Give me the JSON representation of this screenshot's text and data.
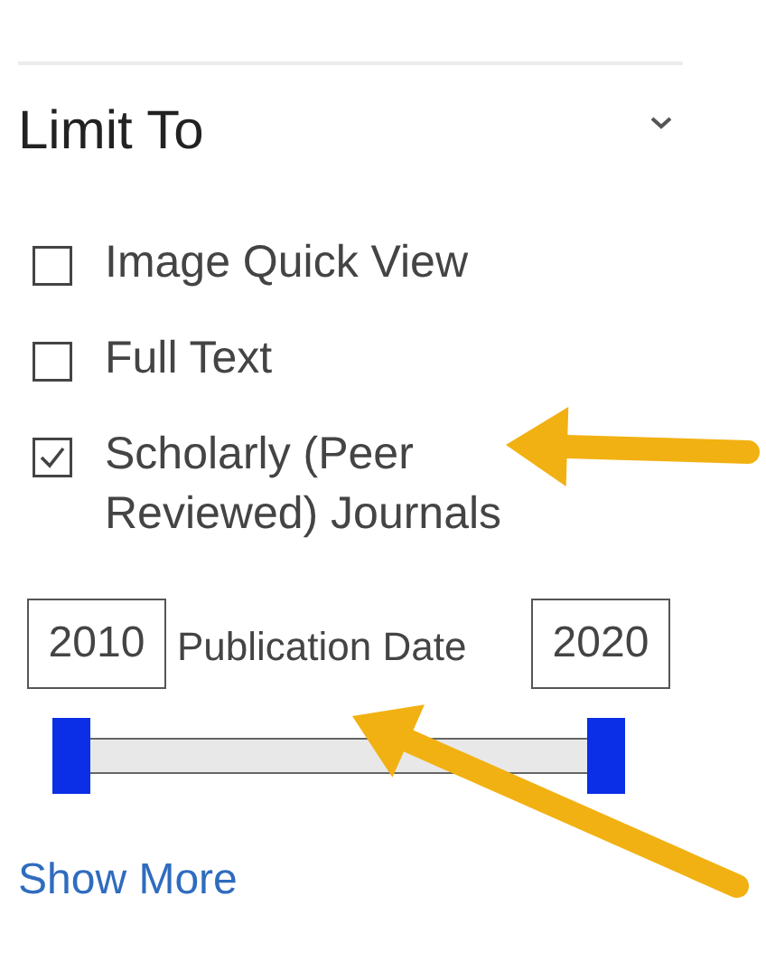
{
  "panel": {
    "title": "Limit To",
    "expanded": true
  },
  "options": [
    {
      "label": "Image Quick View",
      "checked": false
    },
    {
      "label": "Full Text",
      "checked": false
    },
    {
      "label": "Scholarly (Peer Reviewed) Journals",
      "checked": true
    }
  ],
  "date_range": {
    "from": "2010",
    "label": "Publication Date",
    "to": "2020",
    "thumbs": [
      {
        "level": 0
      },
      {
        "level": 1
      }
    ]
  },
  "show_more": "Show More"
}
